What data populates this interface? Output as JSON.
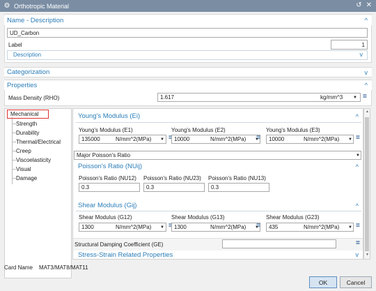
{
  "window": {
    "title": "Orthotropic Material"
  },
  "name_section": {
    "title": "Name - Description",
    "name_value": "UD_Carbon",
    "label_caption": "Label",
    "label_value": "1",
    "description_title": "Description"
  },
  "categorization": {
    "title": "Categorization"
  },
  "properties": {
    "title": "Properties",
    "density_label": "Mass Density (RHO)",
    "density_value": "1.617",
    "density_unit": "kg/mm^3"
  },
  "tree": {
    "items": [
      "Mechanical",
      "Strength",
      "Durability",
      "Thermal/Electrical",
      "Creep",
      "Viscoelasticity",
      "Visual",
      "Damage"
    ]
  },
  "youngs": {
    "title": "Young's Modulus (Ei)",
    "e1_label": "Young's Modulus (E1)",
    "e1_value": "135000",
    "e1_unit": "N/mm^2(MPa)",
    "e2_label": "Young's Modulus (E2)",
    "e2_value": "10000",
    "e2_unit": "N/mm^2(MPa)",
    "e3_label": "Young's Modulus (E3)",
    "e3_value": "10000",
    "e3_unit": "N/mm^2(MPa)"
  },
  "poisson_mode": {
    "value": "Major Poisson's Ratio"
  },
  "poisson": {
    "title": "Poisson's Ratio (NUij)",
    "nu12_label": "Poisson's Ratio (NU12)",
    "nu12_value": "0.3",
    "nu23_label": "Poisson's Ratio (NU23)",
    "nu23_value": "0.3",
    "nu13_label": "Poisson's Ratio (NU13)",
    "nu13_value": "0.3"
  },
  "shear": {
    "title": "Shear Modulus (Gij)",
    "g12_label": "Shear Modulus (G12)",
    "g12_value": "1300",
    "g12_unit": "N/mm^2(MPa)",
    "g13_label": "Shear Modulus (G13)",
    "g13_value": "1300",
    "g13_unit": "N/mm^2(MPa)",
    "g23_label": "Shear Modulus (G23)",
    "g23_value": "435",
    "g23_unit": "N/mm^2(MPa)"
  },
  "damping": {
    "label": "Structural Damping Coefficient (GE)",
    "value": ""
  },
  "stress_strain": {
    "title": "Stress-Strain Related Properties"
  },
  "card": {
    "label": "Card Name",
    "value": "MAT3/MAT8/MAT11"
  },
  "buttons": {
    "ok": "OK",
    "cancel": "Cancel"
  },
  "colors": {
    "accent": "#2a7db8",
    "titlebar": "#7a8da3",
    "selection_border": "#e03030"
  }
}
